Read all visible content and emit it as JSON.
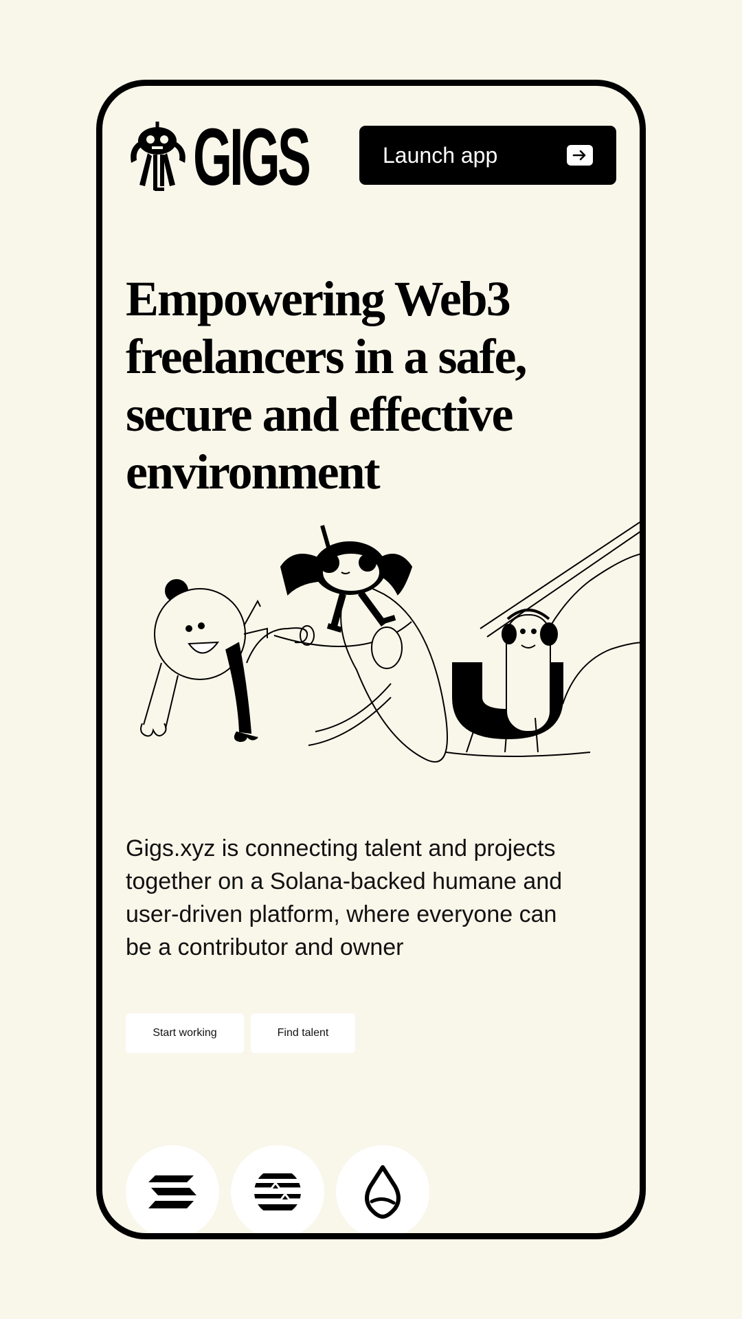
{
  "brand": {
    "name": "GIGS"
  },
  "header": {
    "launch_label": "Launch app"
  },
  "hero": {
    "headline_lines": [
      "Empowering Web3",
      "freelancers in a safe,",
      "secure and effective",
      "environment"
    ],
    "description_lines": [
      "Gigs.xyz is connecting talent and projects",
      "together on a Solana-backed humane and",
      "user-driven platform, where everyone can",
      "be a contributor and owner"
    ]
  },
  "actions": {
    "start_label": "Start working",
    "find_label": "Find talent"
  },
  "partners": [
    {
      "icon": "solana-icon"
    },
    {
      "icon": "aptos-icon"
    },
    {
      "icon": "sui-icon"
    }
  ],
  "colors": {
    "background": "#f9f6ea",
    "ink": "#000000",
    "button_bg": "#ffffff"
  }
}
